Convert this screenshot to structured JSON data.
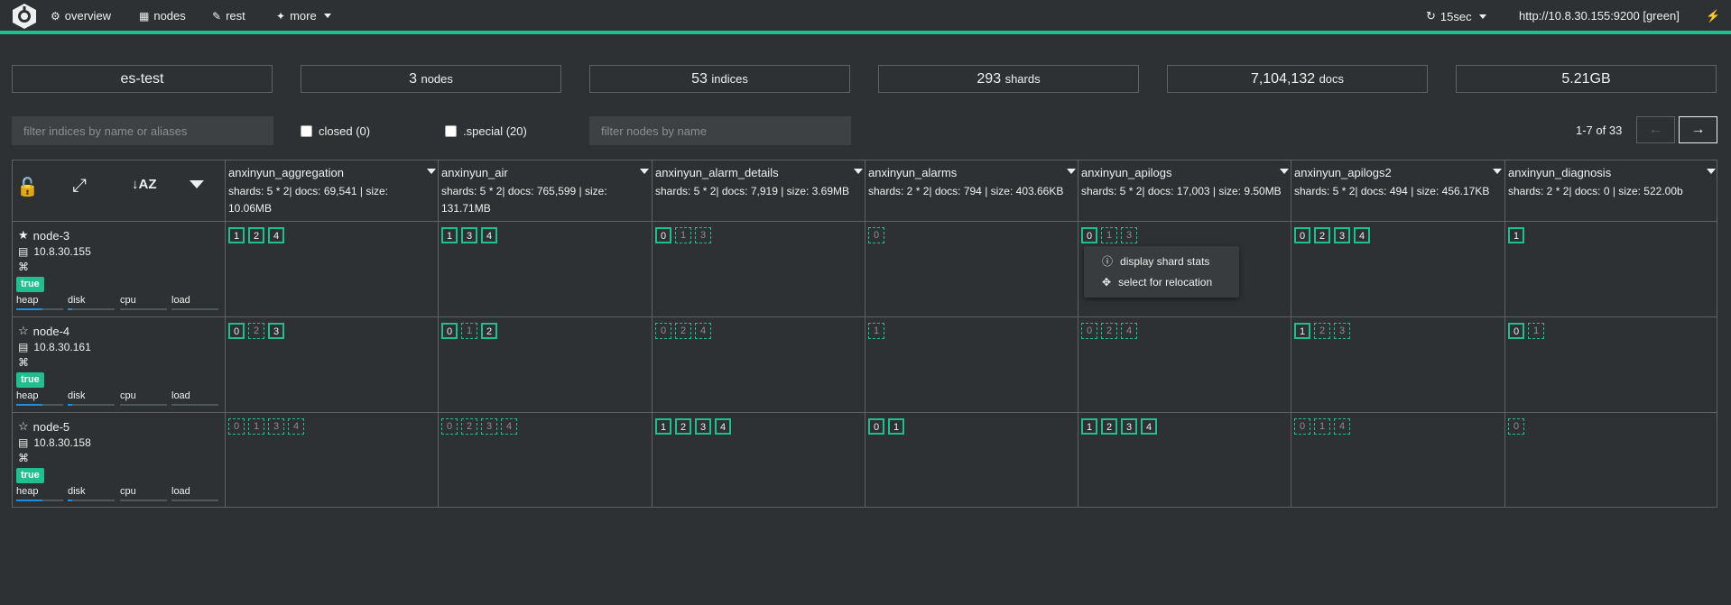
{
  "nav": {
    "items": [
      {
        "label": "overview",
        "icon": "sitemap-icon"
      },
      {
        "label": "nodes",
        "icon": "table-icon"
      },
      {
        "label": "rest",
        "icon": "edit-icon"
      },
      {
        "label": "more",
        "icon": "magic-wand-icon"
      }
    ],
    "refresh": "15sec",
    "host": "http://10.8.30.155:9200 [green]"
  },
  "stats": {
    "cluster": "es-test",
    "nodes": "3",
    "nodes_unit": "nodes",
    "indices": "53",
    "indices_unit": "indices",
    "shards": "293",
    "shards_unit": "shards",
    "docs": "7,104,132",
    "docs_unit": "docs",
    "size": "5.21GB"
  },
  "filters": {
    "indices_placeholder": "filter indices by name or aliases",
    "closed_label": "closed (0)",
    "special_label": ".special (20)",
    "nodes_placeholder": "filter nodes by name"
  },
  "pager": {
    "text": "1-7 of 33",
    "prev": "←",
    "next": "→"
  },
  "indices": [
    {
      "name": "anxinyun_aggregation",
      "info": "shards: 5 * 2| docs: 69,541 | size: 10.06MB"
    },
    {
      "name": "anxinyun_air",
      "info": "shards: 5 * 2| docs: 765,599 | size: 131.71MB"
    },
    {
      "name": "anxinyun_alarm_details",
      "info": "shards: 5 * 2| docs: 7,919 | size: 3.69MB"
    },
    {
      "name": "anxinyun_alarms",
      "info": "shards: 2 * 2| docs: 794 | size: 403.66KB"
    },
    {
      "name": "anxinyun_apilogs",
      "info": "shards: 5 * 2| docs: 17,003 | size: 9.50MB"
    },
    {
      "name": "anxinyun_apilogs2",
      "info": "shards: 5 * 2| docs: 494 | size: 456.17KB"
    },
    {
      "name": "anxinyun_diagnosis",
      "info": "shards: 2 * 2| docs: 0 | size: 522.00b"
    }
  ],
  "nodes": [
    {
      "name": "node-3",
      "ip": "10.8.30.155",
      "master": true,
      "badge": "true",
      "metrics": {
        "heap": 0.55,
        "disk": 0.1,
        "cpu": 0,
        "load": 0
      },
      "shards": [
        [
          {
            "n": "1",
            "p": true
          },
          {
            "n": "2",
            "p": true
          },
          {
            "n": "4",
            "p": true
          }
        ],
        [
          {
            "n": "1",
            "p": true
          },
          {
            "n": "3",
            "p": true
          },
          {
            "n": "4",
            "p": true
          }
        ],
        [
          {
            "n": "0",
            "p": true
          },
          {
            "n": "1",
            "p": false
          },
          {
            "n": "3",
            "p": false
          }
        ],
        [
          {
            "n": "0",
            "p": false
          }
        ],
        [
          {
            "n": "0",
            "p": true
          },
          {
            "n": "1",
            "p": false
          },
          {
            "n": "3",
            "p": false
          }
        ],
        [
          {
            "n": "0",
            "p": true
          },
          {
            "n": "2",
            "p": true
          },
          {
            "n": "3",
            "p": true
          },
          {
            "n": "4",
            "p": true
          }
        ],
        [
          {
            "n": "1",
            "p": true
          }
        ]
      ]
    },
    {
      "name": "node-4",
      "ip": "10.8.30.161",
      "master": false,
      "badge": "true",
      "metrics": {
        "heap": 0.55,
        "disk": 0.1,
        "cpu": 0,
        "load": 0
      },
      "shards": [
        [
          {
            "n": "0",
            "p": true
          },
          {
            "n": "2",
            "p": false
          },
          {
            "n": "3",
            "p": true
          }
        ],
        [
          {
            "n": "0",
            "p": true
          },
          {
            "n": "1",
            "p": false
          },
          {
            "n": "2",
            "p": true
          }
        ],
        [
          {
            "n": "0",
            "p": false
          },
          {
            "n": "2",
            "p": false
          },
          {
            "n": "4",
            "p": false
          }
        ],
        [
          {
            "n": "1",
            "p": false
          }
        ],
        [
          {
            "n": "0",
            "p": false
          },
          {
            "n": "2",
            "p": false
          },
          {
            "n": "4",
            "p": false
          }
        ],
        [
          {
            "n": "1",
            "p": true
          },
          {
            "n": "2",
            "p": false
          },
          {
            "n": "3",
            "p": false
          }
        ],
        [
          {
            "n": "0",
            "p": true
          },
          {
            "n": "1",
            "p": false
          }
        ]
      ]
    },
    {
      "name": "node-5",
      "ip": "10.8.30.158",
      "master": false,
      "badge": "true",
      "metrics": {
        "heap": 0.55,
        "disk": 0.1,
        "cpu": 0,
        "load": 0
      },
      "shards": [
        [
          {
            "n": "0",
            "p": false
          },
          {
            "n": "1",
            "p": false
          },
          {
            "n": "3",
            "p": false
          },
          {
            "n": "4",
            "p": false
          }
        ],
        [
          {
            "n": "0",
            "p": false
          },
          {
            "n": "2",
            "p": false
          },
          {
            "n": "3",
            "p": false
          },
          {
            "n": "4",
            "p": false
          }
        ],
        [
          {
            "n": "1",
            "p": true
          },
          {
            "n": "2",
            "p": true
          },
          {
            "n": "3",
            "p": true
          },
          {
            "n": "4",
            "p": true
          }
        ],
        [
          {
            "n": "0",
            "p": true
          },
          {
            "n": "1",
            "p": true
          }
        ],
        [
          {
            "n": "1",
            "p": true
          },
          {
            "n": "2",
            "p": true
          },
          {
            "n": "3",
            "p": true
          },
          {
            "n": "4",
            "p": true
          }
        ],
        [
          {
            "n": "0",
            "p": false
          },
          {
            "n": "1",
            "p": false
          },
          {
            "n": "4",
            "p": false
          }
        ],
        [
          {
            "n": "0",
            "p": false
          }
        ]
      ]
    }
  ],
  "metric_labels": {
    "heap": "heap",
    "disk": "disk",
    "cpu": "cpu",
    "load": "load"
  },
  "context_menu": {
    "items": [
      {
        "label": "display shard stats",
        "icon": "info-circle-icon"
      },
      {
        "label": "select for relocation",
        "icon": "move-arrows-icon"
      }
    ]
  },
  "colors": {
    "accent": "#1fc08e",
    "background": "#2e3133",
    "bar": "#1b8fe0"
  }
}
